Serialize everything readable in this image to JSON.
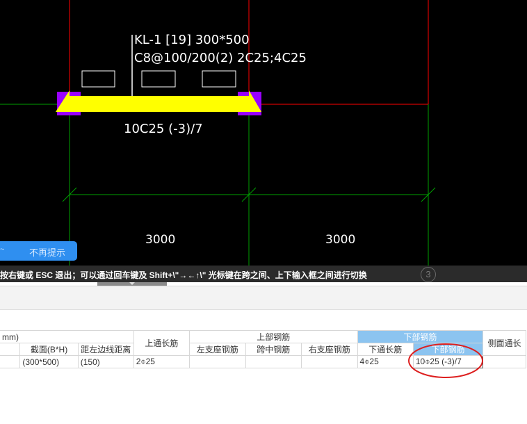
{
  "cad": {
    "beam_label_line1": "KL-1 [19] 300*500",
    "beam_label_line2": "C8@100/200(2) 2C25;4C25",
    "bottom_bar_label": "10C25 (-3)/7",
    "dim_left": "3000",
    "dim_right": "3000",
    "colors": {
      "background": "#000000",
      "beam": "#ffff00",
      "support": "#9900ff",
      "gridline": "#00aa00",
      "column_line": "#ff0000"
    }
  },
  "tip": {
    "arrow": "~",
    "dismiss_label": "不再提示"
  },
  "statusbar": {
    "text": "按右键或 ESC 退出；可以通过回车键及 Shift+\\\"→←↑\\\" 光标键在跨之间、上下输入框之间进行切换",
    "axis_number": "3"
  },
  "table": {
    "group_left": "mm)",
    "group_top": "上部钢筋",
    "group_bottom": "下部钢筋",
    "headers": {
      "section": "截面(B*H)",
      "edge_dist": "距左边线距离",
      "top_through": "上通长筋",
      "left_support": "左支座钢筋",
      "mid_span": "跨中钢筋",
      "right_support": "右支座钢筋",
      "bottom_through": "下通长筋",
      "bottom_bar": "下部钢筋",
      "side_through": "侧面通长"
    },
    "row": {
      "section": "(300*500)",
      "edge_dist": "(150)",
      "top_through": "2⌽25",
      "left_support": "",
      "mid_span": "",
      "right_support": "",
      "bottom_through": "4⌽25",
      "bottom_bar": "10⌽25 (-3)/7",
      "side_through": ""
    }
  }
}
